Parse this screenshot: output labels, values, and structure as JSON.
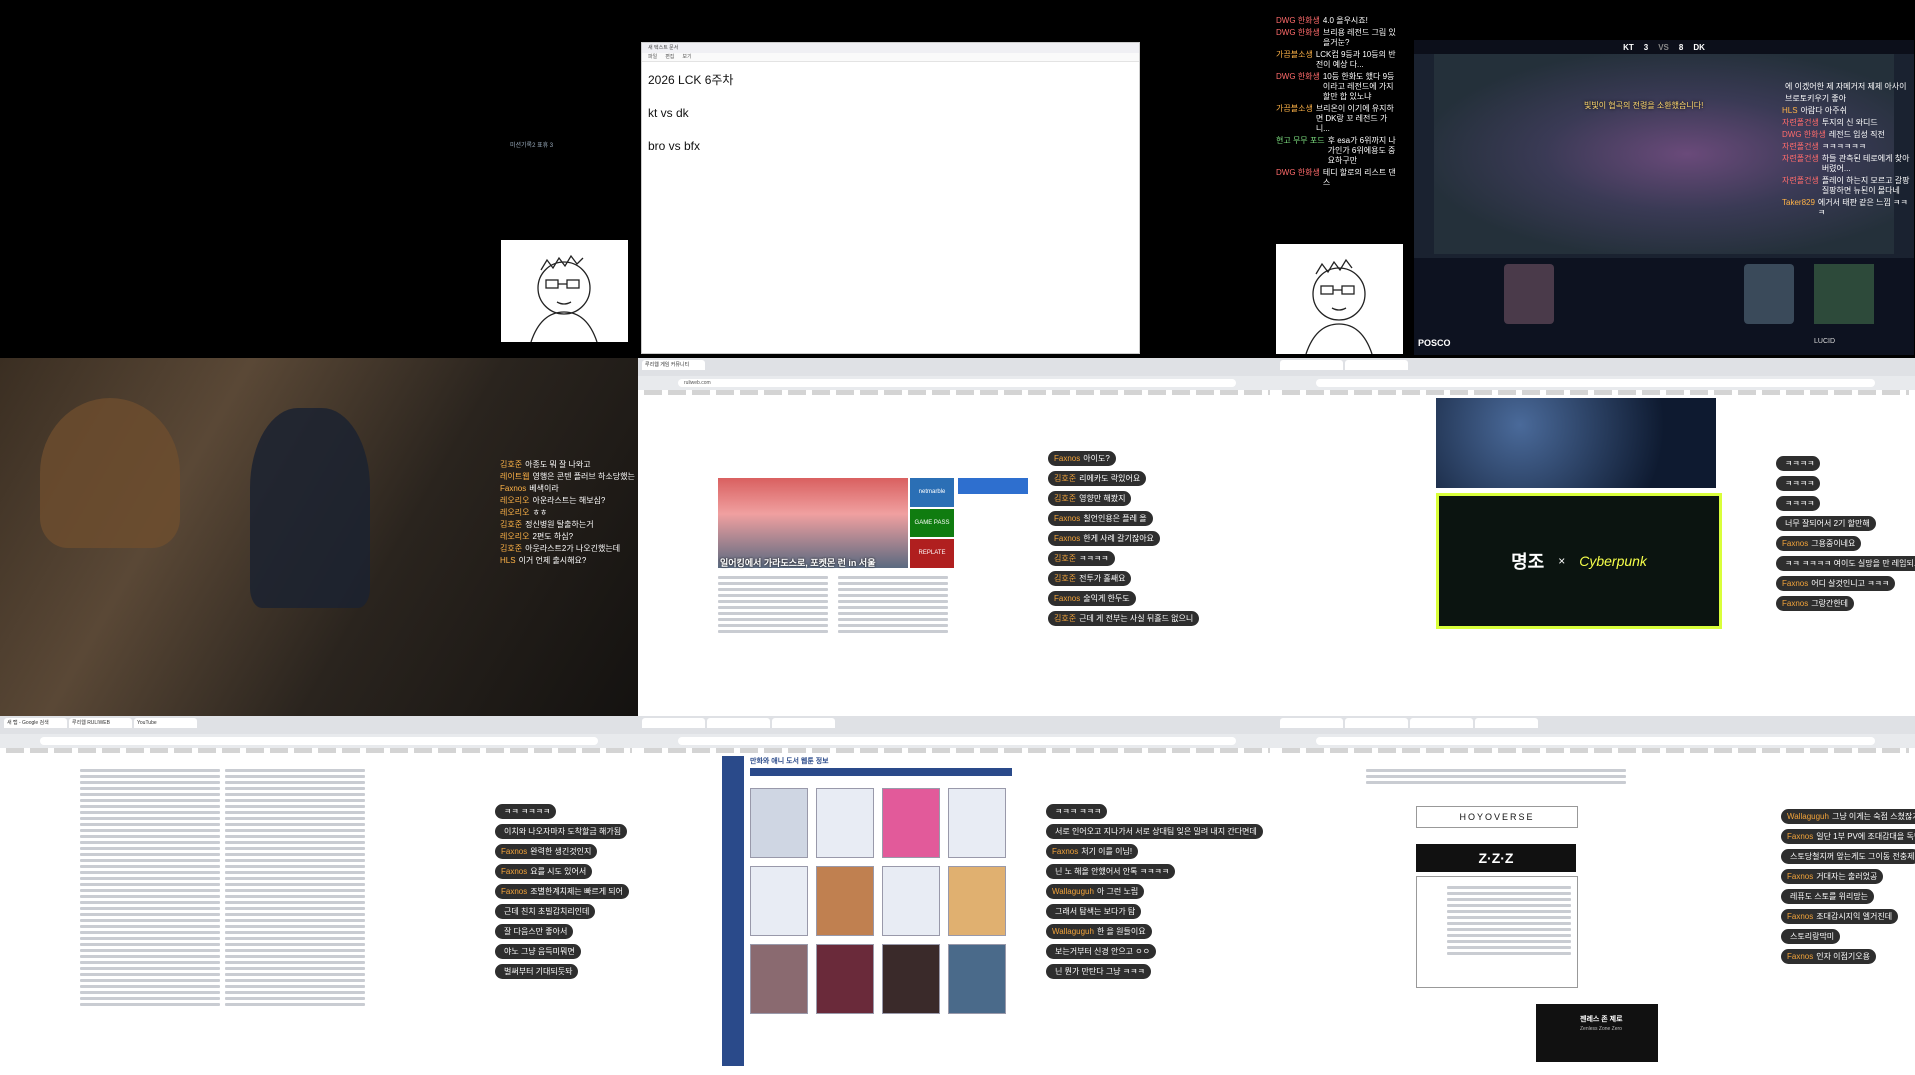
{
  "cells": {
    "c1": {
      "label": "미션기록2 표휴 3"
    },
    "c2": {
      "notepad_tab": "새 텍스트 문서",
      "notepad_menu": [
        "파일",
        "편집",
        "보기"
      ],
      "lines": [
        "2026 LCK 6주차",
        "kt vs dk",
        "bro vs bfx"
      ]
    },
    "c3": {
      "chat": [
        {
          "nick": "DWG 한화생",
          "text": "4.0 올우시죠!"
        },
        {
          "nick": "DWG 한화생",
          "text": "브리용 레전드 그림 있을거눈?"
        },
        {
          "nick": "가끔블소생",
          "text": "LCK컵 9등과 10등의 반전이 예상 다..."
        },
        {
          "nick": "DWG 한화생",
          "text": "10등 한화도 했다 9등이라고 레전드에 가지 할만 합 있노냐"
        },
        {
          "nick": "가끔블소생",
          "text": "브리온이 이기에 유지하면 DK랑 꼬 레전드 가니..."
        },
        {
          "nick": "현고 무무 포드",
          "text": "후 esa가 6위까지 나가인가 6위에용도 중요하구만"
        },
        {
          "nick": "DWG 한화생",
          "text": "테디 할로의 리스트 댄스"
        }
      ]
    },
    "c4": {
      "kill_banner": "빛빛이 협곡의 전령을 소환했습니다!",
      "score": {
        "left_team": "KT",
        "left_kills": "3",
        "right_kills": "8",
        "right_team": "DK"
      },
      "sponsor_left": "POSCO",
      "sponsor_right": "LUCID",
      "chat": [
        {
          "nick": "",
          "text": "에 이겠어한 제 자메거저 제제 아사이"
        },
        {
          "nick": "",
          "text": "브로토키우기 좋아"
        },
        {
          "nick": "HLS",
          "text": "아람다 아주쉬"
        },
        {
          "nick": "자련폴건생",
          "text": "투지의 신 와디드"
        },
        {
          "nick": "DWG 한화생",
          "text": "레전드 입성 직전"
        },
        {
          "nick": "자련폴건생",
          "text": "ㅋㅋㅋㅋㅋㅋ"
        },
        {
          "nick": "자련폴건생",
          "text": "하들 관측된 테로에게 찾아버렸어..."
        },
        {
          "nick": "자련폴건생",
          "text": "플레이 하는지 모르고 갈팡질팡하면 뉴된이 몰다네"
        },
        {
          "nick": "Taker829",
          "text": "에거서 태판 같은 느낌 ㅋㅋㅋ"
        }
      ]
    },
    "c5": {
      "chat": [
        {
          "nick": "김호준",
          "text": "아종도 뭐 잘 나와고"
        },
        {
          "nick": "레이트웹",
          "text": "영행은 콘텐 플러브 하소당했는"
        },
        {
          "nick": "Faxnos",
          "text": "베색이라"
        },
        {
          "nick": "레오리오",
          "text": "아운라스트는 해보심?"
        },
        {
          "nick": "레오리오",
          "text": "ㅎㅎ"
        },
        {
          "nick": "김호준",
          "text": "정신병원 탈출하는거"
        },
        {
          "nick": "레오리오",
          "text": "2편도 하심?"
        },
        {
          "nick": "김호준",
          "text": "아웃라스트2가 나오긴했는데"
        },
        {
          "nick": "HLS",
          "text": "이거 언제 출시해요?"
        }
      ]
    },
    "c6": {
      "tab": "루리웹 게임 커뮤니티",
      "url": "ruliweb.com",
      "banner_caption": "일어킹에서 가라도스로, 포켓몬 런 in 서울",
      "side_promo": [
        "netmarble",
        "GAME PASS",
        "REPLATE"
      ],
      "chat": [
        {
          "nick": "Faxnos",
          "text": "아이도?"
        },
        {
          "nick": "김호준",
          "text": "리에카도 락있어요"
        },
        {
          "nick": "김호준",
          "text": "영향만 해봤지"
        },
        {
          "nick": "Faxnos",
          "text": "칠언인용은 플레 올"
        },
        {
          "nick": "Faxnos",
          "text": "한게 사례 갈기잖아요"
        },
        {
          "nick": "김호준",
          "text": "ㅋㅋㅋㅋ"
        },
        {
          "nick": "김호준",
          "text": "전투가 훌쌔요"
        },
        {
          "nick": "Faxnos",
          "text": "술익게 한두도"
        },
        {
          "nick": "김호준",
          "text": "근데 게 전부는 사실 뒤홀드 없으니"
        }
      ]
    },
    "c7": {
      "promo_title": "명조",
      "promo_x": "×",
      "promo_partner": "Cyberpunk",
      "chat": [
        {
          "nick": "",
          "text": "ㅋㅋㅋㅋ"
        },
        {
          "nick": "",
          "text": "ㅋㅋㅋㅋ"
        },
        {
          "nick": "",
          "text": "ㅋㅋㅋㅋ"
        },
        {
          "nick": "",
          "text": "너무 잘되어서 2기 할만해"
        },
        {
          "nick": "Faxnos",
          "text": "그용중이네요"
        },
        {
          "nick": "",
          "text": "ㅋㅋ ㅋㅋㅋㅋ 여이도 실망을 만 레임되고"
        },
        {
          "nick": "Faxnos",
          "text": "어디 살것인니고 ㅋㅋㅋ"
        },
        {
          "nick": "Faxnos",
          "text": "그랑간한데"
        }
      ]
    },
    "c8": {
      "tabs": [
        "새 탭 - Google 검색",
        "루리웹 RULIWEB",
        "YouTube"
      ],
      "chat": [
        {
          "nick": "",
          "text": "ㅋㅋ ㅋㅋㅋㅋ"
        },
        {
          "nick": "",
          "text": "이치와 나오자마자 도착할금 해가됨"
        },
        {
          "nick": "Faxnos",
          "text": "완력한 생긴것인지"
        },
        {
          "nick": "Faxnos",
          "text": "요를 시도 있어서"
        },
        {
          "nick": "Faxnos",
          "text": "조별한계치제는 빠르게 되어"
        },
        {
          "nick": "",
          "text": "근데 친치 초빌감치리인데"
        },
        {
          "nick": "",
          "text": "잘 다음스만 좋아서"
        },
        {
          "nick": "",
          "text": "야노 그냥 음득미뭐면"
        },
        {
          "nick": "",
          "text": "벌써부터 기대되듯돠"
        }
      ]
    },
    "c9": {
      "board_title": "만화와 애니 도서 웹툰 정보",
      "chat": [
        {
          "nick": "",
          "text": "ㅋㅋㅋ ㅋㅋㅋ"
        },
        {
          "nick": "",
          "text": "서로 인어오고 지나가서 서로 상대팀 잊은 밀려 내지 간다면데"
        },
        {
          "nick": "Faxnos",
          "text": "처기 이를 이님!"
        },
        {
          "nick": "",
          "text": "닌 노 해올 안했어서 안톡 ㅋㅋㅋㅋ"
        },
        {
          "nick": "Wallaguguh",
          "text": "아 그런 노립"
        },
        {
          "nick": "",
          "text": "그래서 탐색는 보다가 탐"
        },
        {
          "nick": "Wallaguguh",
          "text": "한 을 원들이요"
        },
        {
          "nick": "",
          "text": "보는거부터 신경 안으고 ㅇㅇ"
        },
        {
          "nick": "",
          "text": "닌 뭔가 만탄다 그냥 ㅋㅋㅋ"
        }
      ]
    },
    "c10": {
      "brand": "HOYOVERSE",
      "game_logo": "Z·Z·Z",
      "game_title": "젠레스 존 제로",
      "game_sub": "Zenless Zone Zero",
      "chat": [
        {
          "nick": "Wallaguguh",
          "text": "그냥 이게는 숙점 스쳤잖거"
        },
        {
          "nick": "Faxnos",
          "text": "일단 1부 PV에 조대감대을 독민겠세도"
        },
        {
          "nick": "",
          "text": "스토당철지꺼 앞는게도 그이동 전충제"
        },
        {
          "nick": "Faxnos",
          "text": "거대자는 출러었공"
        },
        {
          "nick": "",
          "text": "레퓨도 스토를 위리망는"
        },
        {
          "nick": "Faxnos",
          "text": "조대감시지익 엘거진데"
        },
        {
          "nick": "",
          "text": "스토리랑막미"
        },
        {
          "nick": "Faxnos",
          "text": "인자 이점기오용"
        }
      ]
    }
  }
}
